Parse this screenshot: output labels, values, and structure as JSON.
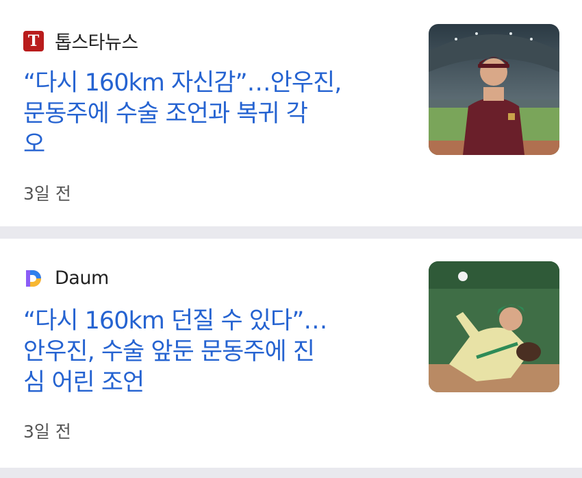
{
  "articles": [
    {
      "source": "톱스타뉴스",
      "logo_letter": "T",
      "headline_lines": [
        "“다시 160km 자신감”…안우진,",
        "문동주에 수술 조언과 복귀 각",
        "오"
      ],
      "time": "3일 전",
      "thumbnail": "baseball-player-standing-in-stadium"
    },
    {
      "source": "Daum",
      "logo_letter": "D",
      "headline_lines": [
        "“다시 160km 던질 수 있다”…",
        "안우진, 수술 앞둔 문동주에 진",
        "심 어린 조언"
      ],
      "time": "3일 전",
      "thumbnail": "baseball-pitcher-throwing"
    }
  ],
  "colors": {
    "headline": "#2563d1",
    "background": "#e9e9ee",
    "card": "#ffffff",
    "topstar_logo": "#b91c1c"
  }
}
